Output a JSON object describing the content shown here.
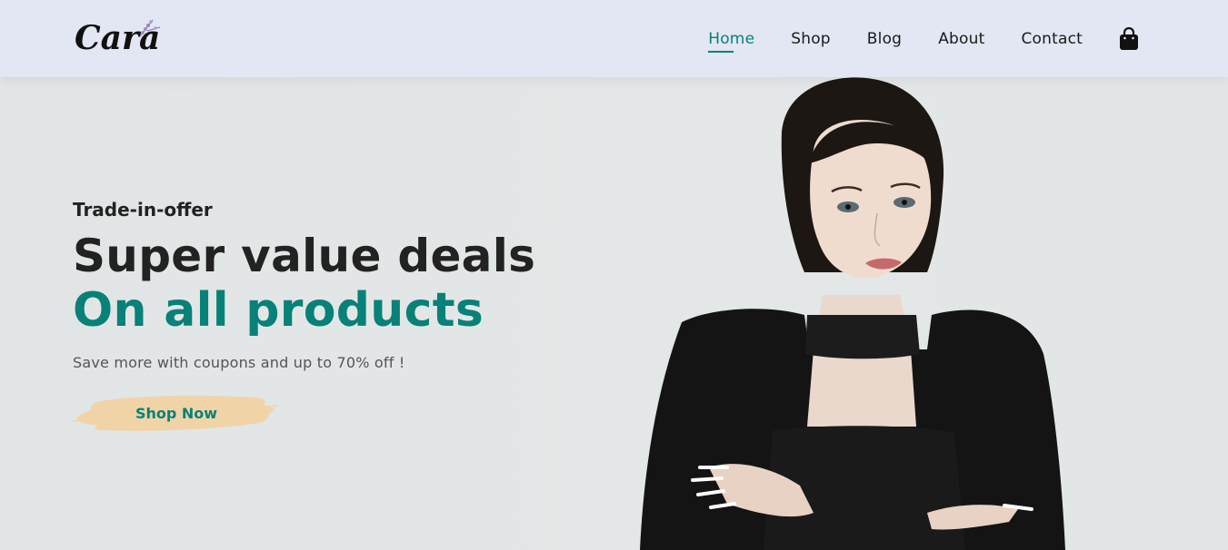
{
  "brand": {
    "logo_text": "Cara"
  },
  "nav": {
    "items": [
      {
        "label": "Home",
        "active": true
      },
      {
        "label": "Shop",
        "active": false
      },
      {
        "label": "Blog",
        "active": false
      },
      {
        "label": "About",
        "active": false
      },
      {
        "label": "Contact",
        "active": false
      }
    ],
    "cart_icon": "shopping-bag-icon"
  },
  "hero": {
    "tag": "Trade-in-offer",
    "headline": "Super value deals",
    "subheadline": "On all products",
    "promo": "Save more with coupons and up to 70% off !",
    "cta_label": "Shop Now"
  },
  "colors": {
    "accent": "#088178",
    "header_bg": "#e3e6f3",
    "cta_brush": "#f0d4a8",
    "text_dark": "#222222"
  }
}
